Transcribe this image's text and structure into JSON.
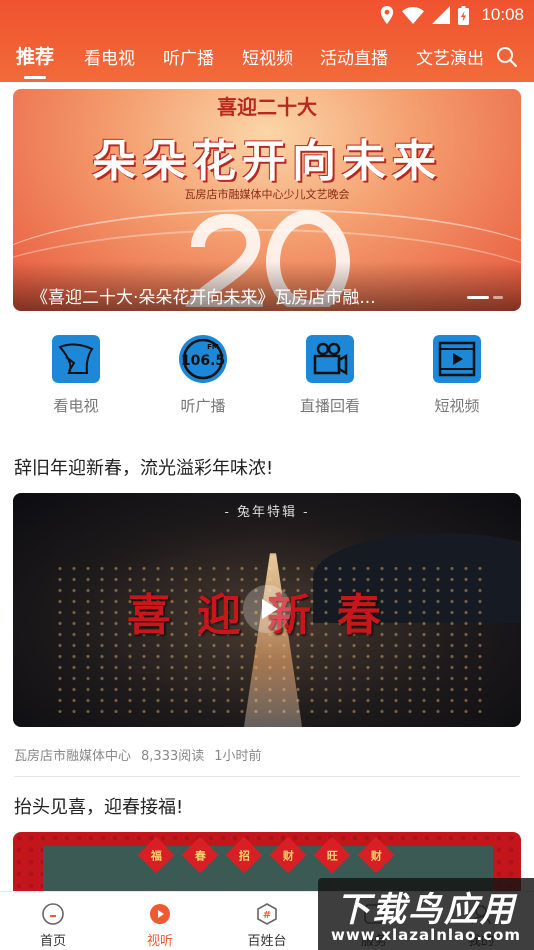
{
  "status_bar": {
    "time": "10:08"
  },
  "top_nav": {
    "tabs": [
      {
        "label": "推荐",
        "active": true
      },
      {
        "label": "看电视"
      },
      {
        "label": "听广播"
      },
      {
        "label": "短视频"
      },
      {
        "label": "活动直播"
      },
      {
        "label": "文艺演出"
      }
    ],
    "search_icon": "search-icon"
  },
  "banner": {
    "top_title": "喜迎二十大",
    "main_title": "朵朵花开向未来",
    "subtitle": "瓦房店市融媒体中心少儿文艺晚会",
    "caption": "《喜迎二十大·朵朵花开向未来》瓦房店市融...",
    "active_index": 0,
    "slide_count": 2
  },
  "shortcuts": [
    {
      "label": "看电视",
      "icon": "tv-icon",
      "color": "#1e88d8"
    },
    {
      "label": "听广播",
      "icon": "radio-fm-icon",
      "color": "#1e88d8"
    },
    {
      "label": "直播回看",
      "icon": "video-camera-icon",
      "color": "#1e88d8"
    },
    {
      "label": "短视频",
      "icon": "play-video-icon",
      "color": "#1e88d8"
    }
  ],
  "articles": [
    {
      "title": "辞旧年迎新春，流光溢彩年味浓!",
      "video_tag": "- 兔年特辑 -",
      "video_title": "喜迎新春",
      "source": "瓦房店市融媒体中心",
      "reads": "8,333阅读",
      "time": "1小时前"
    },
    {
      "title": "抬头见喜，迎春接福!",
      "poster_words": [
        "福",
        "春",
        "招",
        "财",
        "旺",
        "财"
      ]
    }
  ],
  "bottom_nav": [
    {
      "label": "首页",
      "icon": "home-icon",
      "active": false
    },
    {
      "label": "视听",
      "icon": "play-circle-icon",
      "active": true
    },
    {
      "label": "百姓台",
      "icon": "hashtag-icon",
      "active": false
    },
    {
      "label": "服务",
      "icon": "service-icon",
      "active": false
    },
    {
      "label": "我的",
      "icon": "profile-icon",
      "active": false
    }
  ],
  "watermark": {
    "title": "下载鸟应用",
    "url": "www.xlazalnlao.com"
  },
  "colors": {
    "accent": "#f05a33",
    "header": "#f0522f",
    "icon_blue": "#1e88d8"
  }
}
